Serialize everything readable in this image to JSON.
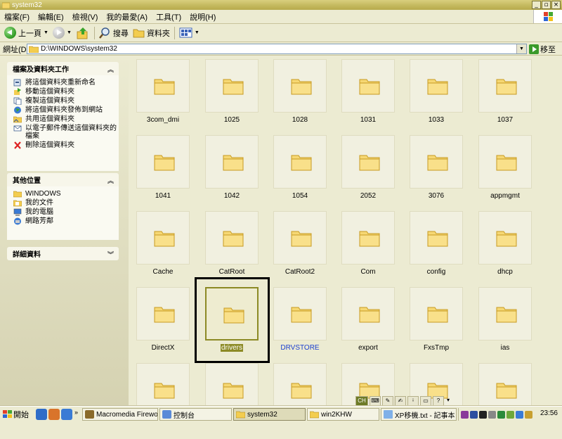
{
  "window": {
    "title": "system32"
  },
  "menu": [
    "檔案(F)",
    "編輯(E)",
    "檢視(V)",
    "我的最愛(A)",
    "工具(T)",
    "說明(H)"
  ],
  "toolbar": {
    "back_label": "上一頁",
    "search_label": "搜尋",
    "folders_label": "資料夾"
  },
  "address": {
    "label": "網址(D)",
    "path": "D:\\WINDOWS\\system32",
    "go_label": "移至"
  },
  "tasks_panel": {
    "title": "檔案及資料夾工作",
    "items": [
      "將這個資料夾重新命名",
      "移動這個資料夾",
      "複製這個資料夾",
      "將這個資料夾發佈到網站",
      "共用這個資料夾",
      "以電子郵件傳送這個資料夾的檔案",
      "刪除這個資料夾"
    ]
  },
  "places_panel": {
    "title": "其他位置",
    "items": [
      "WINDOWS",
      "我的文件",
      "我的電腦",
      "網路芳鄰"
    ]
  },
  "details_panel": {
    "title": "詳細資料"
  },
  "folders": [
    "3com_dmi",
    "1025",
    "1028",
    "1031",
    "1033",
    "1037",
    "1041",
    "1042",
    "1054",
    "2052",
    "3076",
    "appmgmt",
    "Cache",
    "CatRoot",
    "CatRoot2",
    "Com",
    "config",
    "dhcp",
    "DirectX",
    "drivers",
    "DRVSTORE",
    "export",
    "FxsTmp",
    "ias",
    "",
    "",
    "",
    "",
    "",
    ""
  ],
  "selected_folder": "drivers",
  "language_bar": {
    "ime": "CH"
  },
  "taskbar": {
    "start_label": "開始",
    "tasks": [
      "Macromedia Firewo...",
      "控制台",
      "system32",
      "win2KHW",
      "XP移機.txt - 記事本"
    ],
    "clock": "23:56"
  },
  "colors": {
    "selection": "#8c8a25",
    "highlight_box": "#000000",
    "link_blue": "#1b3fd0"
  }
}
